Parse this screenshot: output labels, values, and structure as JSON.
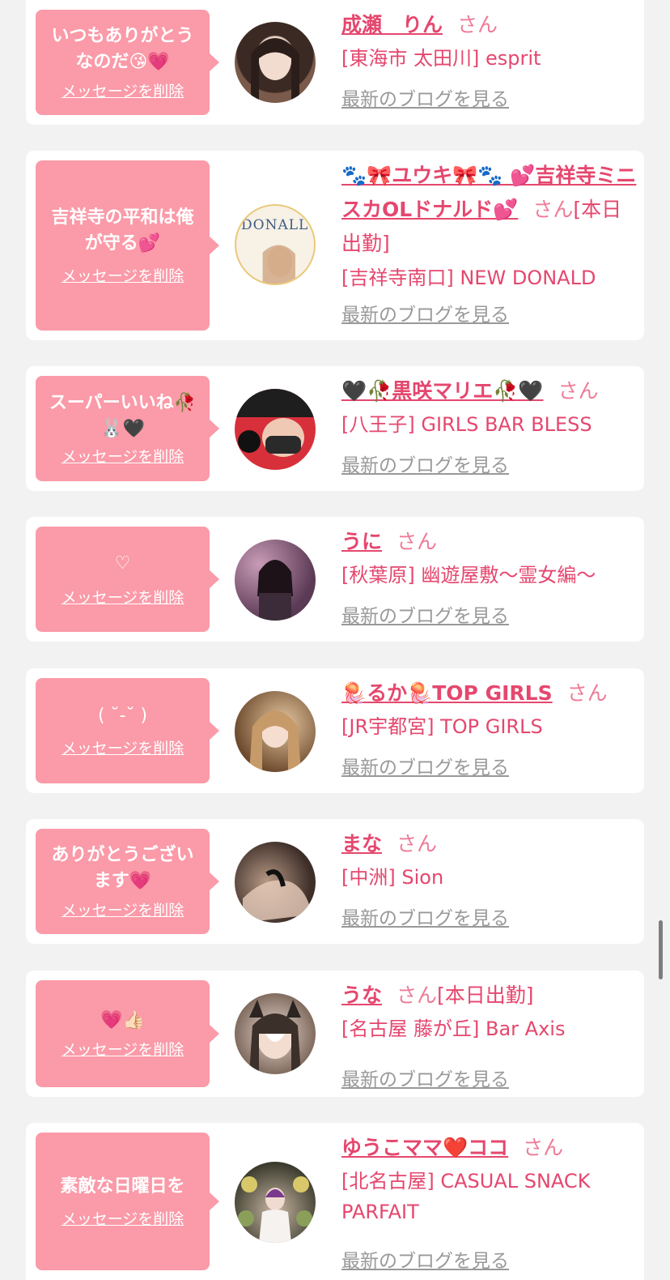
{
  "delete_label": "メッセージを削除",
  "blog_label": "最新のブログを見る",
  "san_suffix": "さん",
  "items": [
    {
      "message": "いつもありがとうなのだ😘💗",
      "name": "成瀬　りん",
      "after_san": "",
      "shop": "[東海市 太田川] esprit",
      "avatar_icon": "user-photo"
    },
    {
      "message": "吉祥寺の平和は俺が守る💕",
      "name": "🐾🎀ユウキ🎀🐾 💕吉祥寺ミニスカOLドナルド💕",
      "after_san": "[本日出勤]",
      "shop": "[吉祥寺南口] NEW DONALD",
      "avatar_text": "DONALL"
    },
    {
      "message": "スーパーいいね🥀🐰🖤",
      "name": "🖤🥀黒咲マリエ🥀🖤",
      "after_san": "",
      "shop": "[八王子] GIRLS BAR BLESS",
      "avatar_icon": "user-photo"
    },
    {
      "message": "♡",
      "name": "うに",
      "after_san": "",
      "shop": "[秋葉原] 幽遊屋敷～霊女編～",
      "avatar_icon": "user-photo"
    },
    {
      "message": "( ˘-˘ )",
      "name": "🪼るか🪼TOP GIRLS",
      "after_san": "",
      "shop": "[JR宇都宮] TOP GIRLS",
      "avatar_icon": "user-photo"
    },
    {
      "message": "ありがとうございます💗",
      "name": "まな",
      "after_san": "",
      "shop": "[中洲] Sion",
      "avatar_icon": "user-photo"
    },
    {
      "message": "💗👍🏻",
      "name": "うな",
      "after_san": "[本日出勤]",
      "shop": "[名古屋 藤が丘] Bar Axis",
      "avatar_icon": "user-photo"
    },
    {
      "message": "素敵な日曜日を",
      "name": "ゆうこママ❤️ココ",
      "after_san": "",
      "shop": "[北名古屋] CASUAL SNACK PARFAIT",
      "avatar_icon": "user-photo"
    }
  ],
  "colors": {
    "bubble": "#fb9aa8",
    "name": "#e5476e",
    "blog": "#999999",
    "background": "#f2f2f2"
  }
}
